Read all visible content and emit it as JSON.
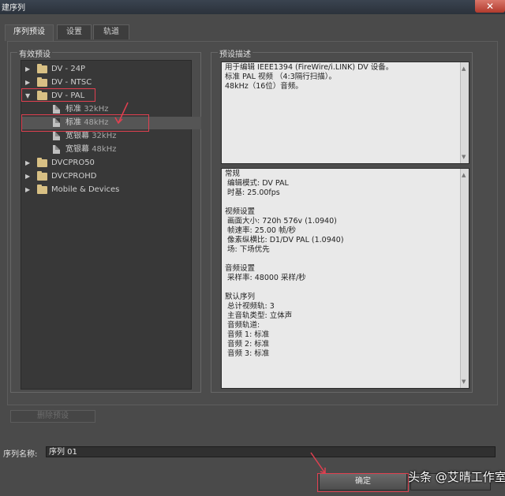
{
  "window": {
    "title": "建序列",
    "close_glyph": "✕"
  },
  "tabs": [
    {
      "label": "序列预设"
    },
    {
      "label": "设置"
    },
    {
      "label": "轨道"
    }
  ],
  "presets": {
    "group_label": "有效预设",
    "items": [
      {
        "label": "DV - 24P"
      },
      {
        "label": "DV - NTSC"
      },
      {
        "label": "DV - PAL"
      },
      {
        "label": "标准",
        "sub": "32kHz"
      },
      {
        "label": "标准",
        "sub": "48kHz"
      },
      {
        "label": "宽银幕",
        "sub": "32kHz"
      },
      {
        "label": "宽银幕",
        "sub": "48kHz"
      },
      {
        "label": "DVCPRO50"
      },
      {
        "label": "DVCPROHD"
      },
      {
        "label": "Mobile & Devices"
      }
    ],
    "delete_label": "删除预设"
  },
  "description": {
    "group_label": "预设描述",
    "summary": "用于编辑 IEEE1394 (FireWire/i.LINK) DV 设备。\n标准 PAL 视频 （4:3隔行扫描）。\n48kHz（16位）音频。",
    "details": "常规\n 编辑模式: DV PAL\n 时基: 25.00fps\n\n视频设置\n 画面大小: 720h 576v (1.0940)\n 帧速率: 25.00 帧/秒\n 像素纵横比: D1/DV PAL (1.0940)\n 场: 下场优先\n\n音频设置\n 采样率: 48000 采样/秒\n\n默认序列\n 总计视频轨: 3\n 主音轨类型: 立体声\n 音频轨道:\n 音频 1: 标准\n 音频 2: 标准\n 音频 3: 标准"
  },
  "sequence_name": {
    "label": "序列名称:",
    "value": "序列 01"
  },
  "buttons": {
    "ok": "确定"
  },
  "watermark": "头条 @艾晴工作室",
  "colors": {
    "annotation": "#e04050",
    "folder": "#d8c084"
  }
}
